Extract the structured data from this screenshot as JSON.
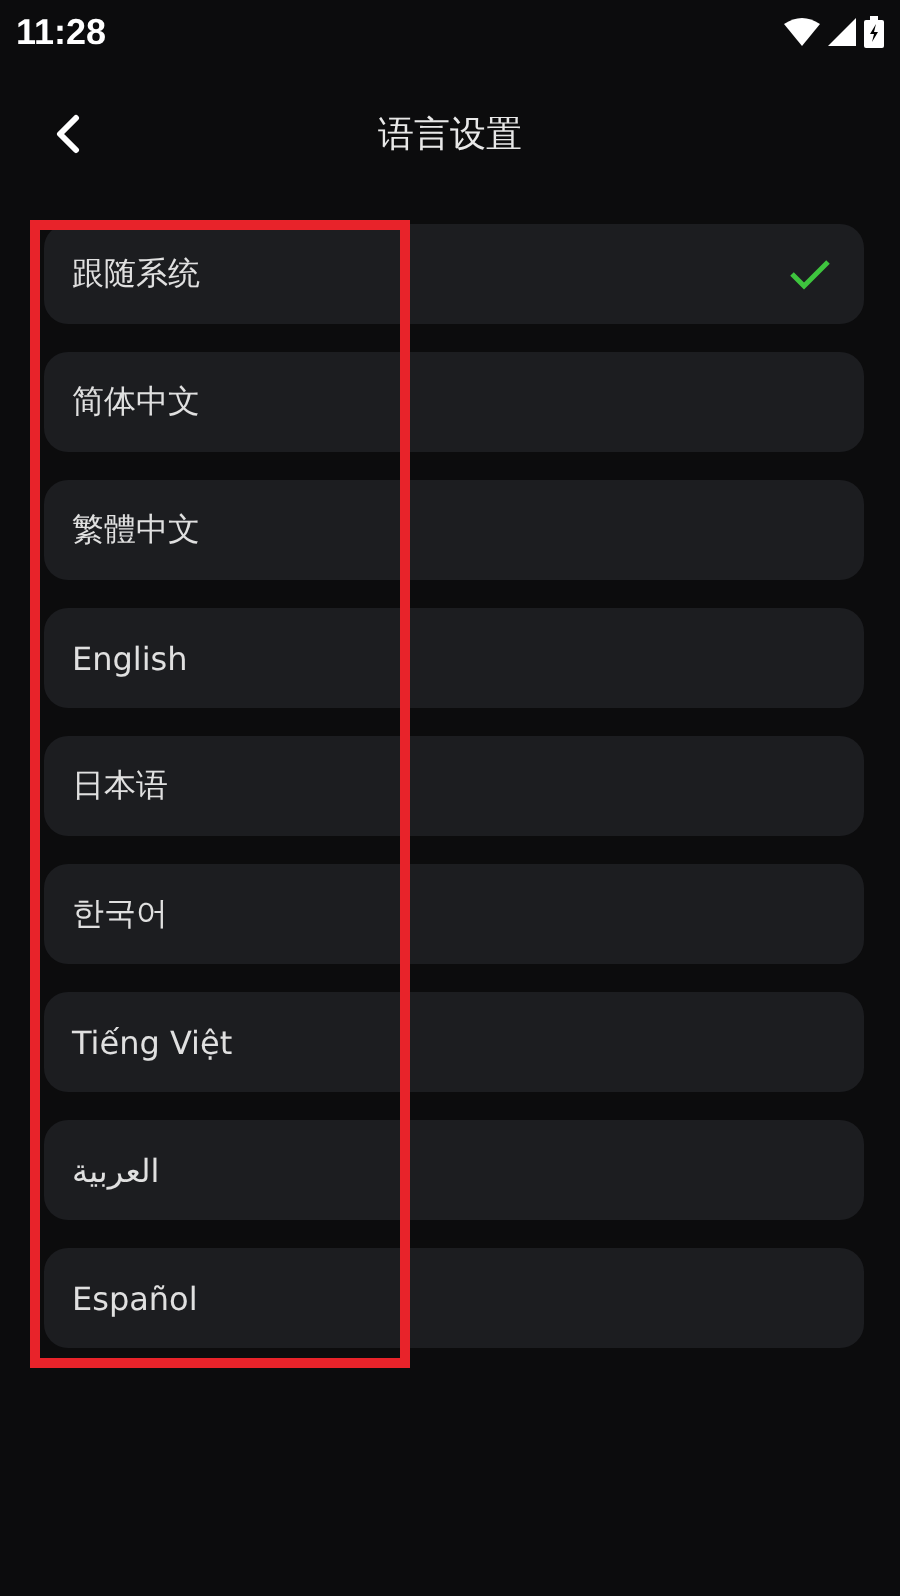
{
  "status_bar": {
    "time": "11:28"
  },
  "header": {
    "title": "语言设置"
  },
  "languages": [
    {
      "label": "跟随系统",
      "selected": true
    },
    {
      "label": "简体中文",
      "selected": false
    },
    {
      "label": "繁體中文",
      "selected": false
    },
    {
      "label": "English",
      "selected": false
    },
    {
      "label": "日本语",
      "selected": false
    },
    {
      "label": "한국어",
      "selected": false
    },
    {
      "label": "Tiếng Việt",
      "selected": false
    },
    {
      "label": "العربية",
      "selected": false
    },
    {
      "label": "Español",
      "selected": false
    }
  ]
}
